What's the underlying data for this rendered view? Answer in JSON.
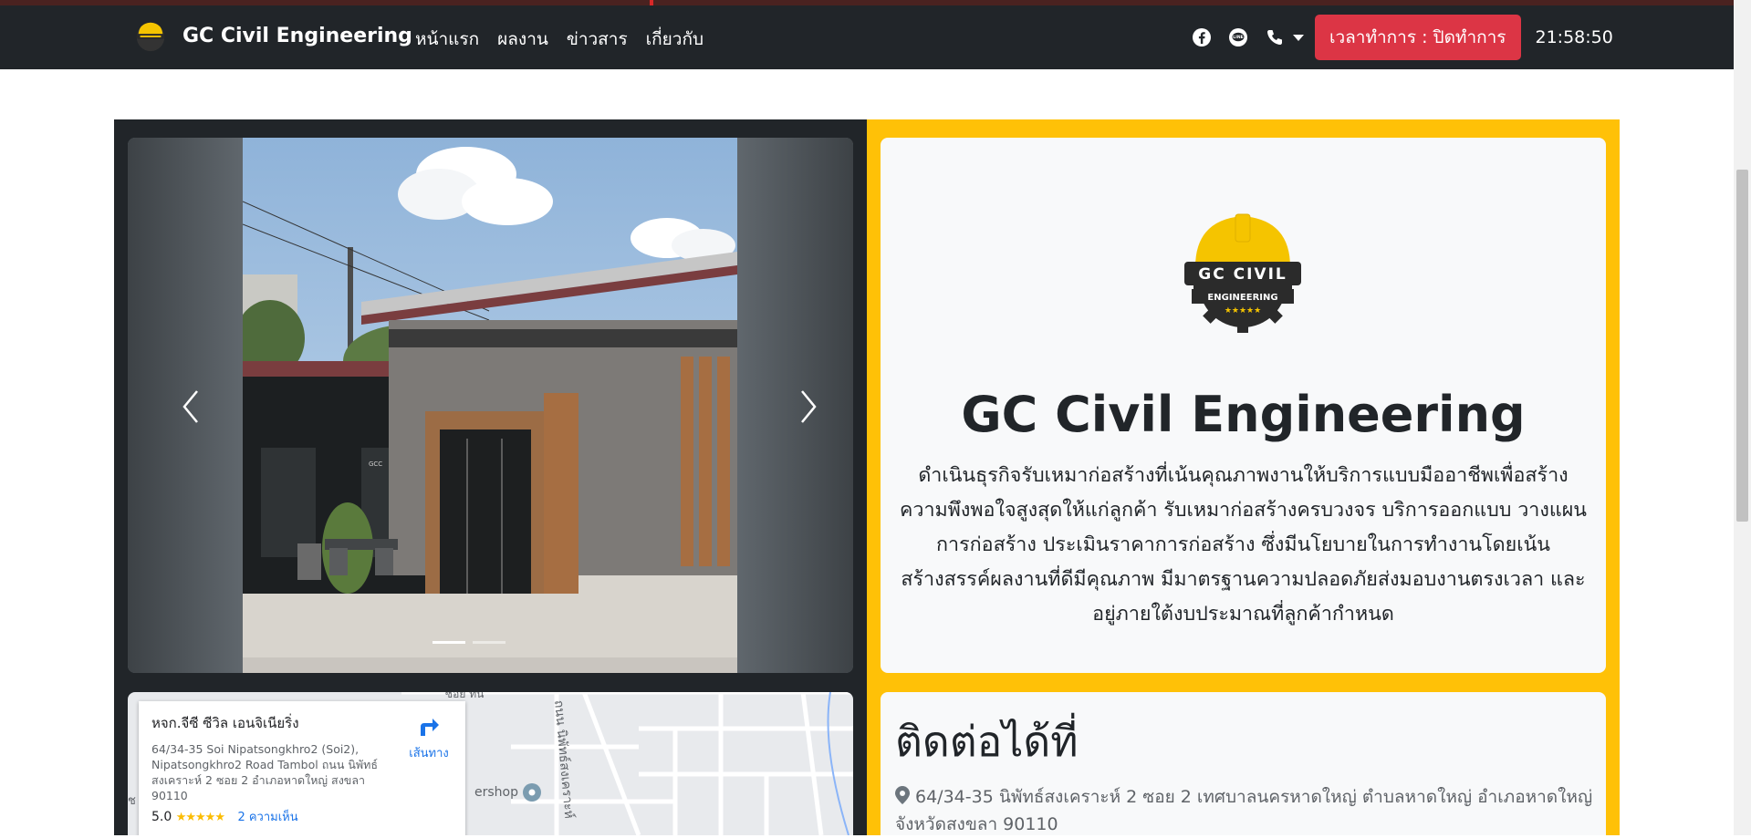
{
  "navbar": {
    "brand": "GC Civil Engineering",
    "links": [
      "หน้าแรก",
      "ผลงาน",
      "ข่าวสาร",
      "เกี่ยวกับ"
    ],
    "icons": [
      "facebook-icon",
      "line-icon",
      "phone-icon"
    ],
    "hours_button": "เวลาทำการ : ปิดทำการ",
    "clock": "21:58:50",
    "colors": {
      "bg": "#212529",
      "hours_button": "#dc3545"
    }
  },
  "about": {
    "logo_text_top": "GC CIVIL",
    "logo_text_bottom": "ENGINEERING",
    "title": "GC Civil Engineering",
    "description": "ดำเนินธุรกิจรับเหมาก่อสร้างที่เน้นคุณภาพงานให้บริการแบบมืออาชีพเพื่อสร้างความพึงพอใจสูงสุดให้แก่ลูกค้า รับเหมาก่อสร้างครบวงจร บริการออกแบบ วางแผนการก่อสร้าง ประเมินราคาการก่อสร้าง ซึ่งมีนโยบายในการทำงานโดยเน้นสร้างสรรค์ผลงานที่ดีมีคุณภาพ มีมาตรฐานความปลอดภัยส่งมอบงานตรงเวลา และอยู่ภายใต้งบประมาณที่ลูกค้ากำหนด",
    "accent": "#ffc107"
  },
  "carousel": {
    "photo_sign": "GCC",
    "slide_count": 2,
    "active_index": 0
  },
  "map": {
    "place_name": "หจก.จีซี ซีวิล เอนจิเนียริ่ง",
    "address": "64/34-35 Soi Nipatsongkhro2 (Soi2), Nipatsongkhro2 Road Tambol ถนน นิพัทธ์สงเคราะห์ 2 ซอย 2 อำเภอหาดใหญ่ สงขลา 90110",
    "rating": "5.0",
    "stars": "★★★★★",
    "reviews": "2 ความเห็น",
    "directions": "เส้นทาง",
    "road_label": "ถนน นิพัทธ์สงเคราะห์",
    "road_label_2": "ซอย ทิน",
    "poi_label": "ershop",
    "side_label": "ช"
  },
  "contact": {
    "title": "ติดต่อได้ที่",
    "address": "64/34-35 นิพัทธ์สงเคราะห์ 2 ซอย 2 เทศบาลนครหาดใหญ่ ตำบลหาดใหญ่ อำเภอหาดใหญ่ จังหวัดสงขลา 90110"
  }
}
